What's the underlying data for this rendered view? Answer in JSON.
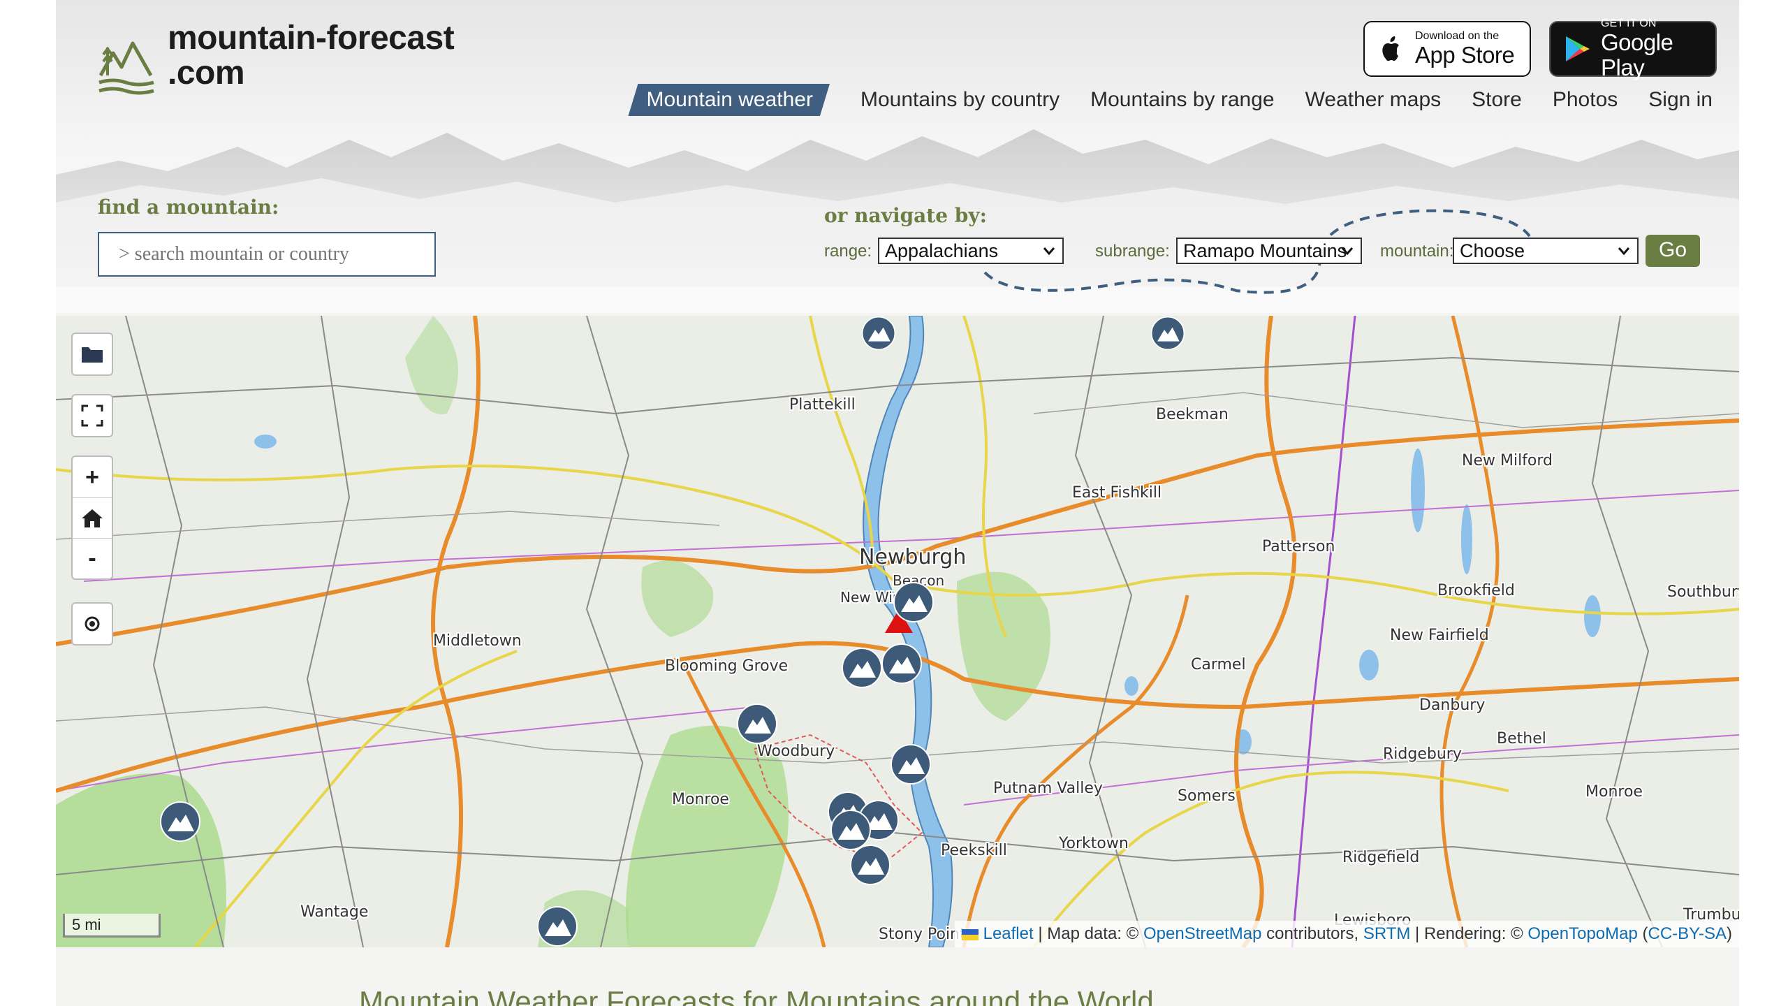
{
  "brand": {
    "line1": "mountain-forecast",
    "line2": ".com"
  },
  "stores": {
    "apple": {
      "small": "Download on the",
      "big": "App Store"
    },
    "google": {
      "small": "GET IT ON",
      "big": "Google Play"
    }
  },
  "nav": {
    "items": [
      {
        "label": "Mountain weather",
        "active": true
      },
      {
        "label": "Mountains by country"
      },
      {
        "label": "Mountains by range"
      },
      {
        "label": "Weather maps"
      },
      {
        "label": "Store"
      },
      {
        "label": "Photos"
      },
      {
        "label": "Sign in"
      }
    ]
  },
  "search": {
    "label": "find a mountain:",
    "placeholder": "> search mountain or country"
  },
  "navigate": {
    "label": "or navigate by:",
    "range_label": "range:",
    "range_value": "Appalachians",
    "subrange_label": "subrange:",
    "subrange_value": "Ramapo Mountains",
    "mountain_label": "mountain:",
    "mountain_value": "Choose",
    "go_label": "Go"
  },
  "map": {
    "controls": {
      "layers_icon": "folder-icon",
      "fullscreen_icon": "fullscreen-icon",
      "zoom_in": "+",
      "home_icon": "home-icon",
      "zoom_out": "-",
      "locate_icon": "locate-icon"
    },
    "scale": "5 mi",
    "places": [
      "Plattekill",
      "Beekman",
      "New Milford",
      "East Fishkill",
      "Newburgh",
      "Beacon",
      "New Windsor",
      "Patterson",
      "Brookfield",
      "Southbury",
      "Middletown",
      "New Fairfield",
      "Carmel",
      "Blooming Grove",
      "Danbury",
      "Woodbury",
      "Bethel",
      "Ridgebury",
      "Monroe",
      "Putnam Valley",
      "Somers",
      "Monroe",
      "Yorktown",
      "Peekskill",
      "Ridgefield",
      "Wantage",
      "Lewisboro",
      "Trumbul",
      "Stony Point"
    ],
    "attribution": {
      "leaflet": "Leaflet",
      "sep1": " | Map data: © ",
      "osm": "OpenStreetMap",
      "contrib": " contributors, ",
      "srtm": "SRTM",
      "sep2": " | Rendering: © ",
      "otm": "OpenTopoMap",
      "open": " (",
      "license": "CC-BY-SA",
      "close": ")"
    }
  },
  "footer": {
    "title": "Mountain Weather Forecasts for Mountains around the World"
  },
  "colors": {
    "nav_active": "#3f5e80",
    "brand_green": "#6a7d43",
    "marker": "#3d5a78",
    "summit": "#dd1111"
  }
}
